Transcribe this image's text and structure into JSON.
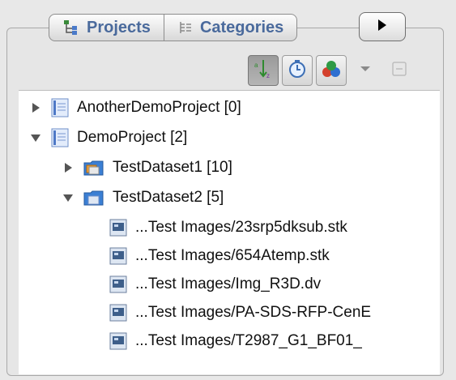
{
  "tabs": [
    {
      "label": "Projects",
      "icon": "tree-hierarchy-icon"
    },
    {
      "label": "Categories",
      "icon": "category-list-icon"
    }
  ],
  "toolbar": {
    "buttons": [
      {
        "icon": "sort-az-icon",
        "pressed": true
      },
      {
        "icon": "clock-icon",
        "pressed": false
      },
      {
        "icon": "color-group-icon",
        "pressed": false
      },
      {
        "icon": "dropdown-arrow-icon",
        "pressed": false
      },
      {
        "icon": "collapse-minus-icon",
        "pressed": false
      }
    ]
  },
  "tree": {
    "nodes": [
      {
        "label": "AnotherDemoProject [0]",
        "type": "project",
        "expanded": false
      },
      {
        "label": "DemoProject [2]",
        "type": "project",
        "expanded": true
      },
      {
        "label": "TestDataset1 [10]",
        "type": "dataset",
        "expanded": false
      },
      {
        "label": "TestDataset2 [5]",
        "type": "dataset",
        "expanded": true
      },
      {
        "label": "...Test Images/23srp5dksub.stk",
        "type": "image"
      },
      {
        "label": "...Test Images/654Atemp.stk",
        "type": "image"
      },
      {
        "label": "...Test Images/Img_R3D.dv",
        "type": "image"
      },
      {
        "label": "...Test Images/PA-SDS-RFP-CenE",
        "type": "image"
      },
      {
        "label": "...Test Images/T2987_G1_BF01_",
        "type": "image"
      }
    ]
  }
}
